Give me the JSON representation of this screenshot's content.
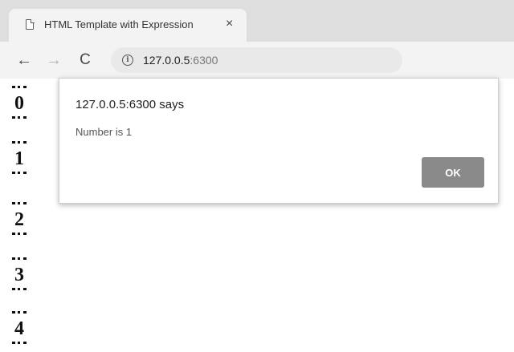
{
  "browser": {
    "tab": {
      "title": "HTML Template with Expression",
      "close_glyph": "×",
      "icon": "page-icon"
    },
    "toolbar": {
      "back_glyph": "←",
      "forward_glyph": "→",
      "reload_glyph": "C",
      "info_glyph": "i",
      "url_host": "127.0.0.5",
      "url_port": ":6300"
    }
  },
  "page": {
    "numbers": [
      "0",
      "1",
      "2",
      "3",
      "4"
    ]
  },
  "dialog": {
    "title": "127.0.0.5:6300 says",
    "message": "Number is 1",
    "ok_label": "OK"
  },
  "colors": {
    "tabstrip": "#dedede",
    "toolbar": "#f3f3f3",
    "ok_button": "#8a8a8a"
  }
}
